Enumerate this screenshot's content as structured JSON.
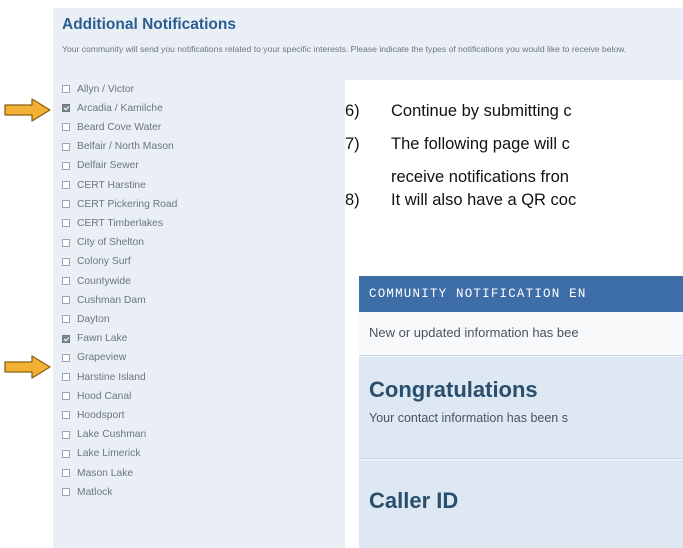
{
  "notifications": {
    "title": "Additional Notifications",
    "description": "Your community will send you notifications related to your specific interests. Please indicate the types of notifications you would like to receive below.",
    "options": [
      {
        "label": "Allyn / Victor",
        "checked": false
      },
      {
        "label": "Arcadia / Kamilche",
        "checked": true
      },
      {
        "label": "Beard Cove Water",
        "checked": false
      },
      {
        "label": "Belfair / North Mason",
        "checked": false
      },
      {
        "label": "Delfair Sewer",
        "checked": false
      },
      {
        "label": "CERT Harstine",
        "checked": false
      },
      {
        "label": "CERT Pickering Road",
        "checked": false
      },
      {
        "label": "CERT Timberlakes",
        "checked": false
      },
      {
        "label": "City of Shelton",
        "checked": false
      },
      {
        "label": "Colony Surf",
        "checked": false
      },
      {
        "label": "Countywide",
        "checked": false
      },
      {
        "label": "Cushman Dam",
        "checked": false
      },
      {
        "label": "Dayton",
        "checked": false
      },
      {
        "label": "Fawn Lake",
        "checked": true
      },
      {
        "label": "Grapeview",
        "checked": false
      },
      {
        "label": "Harstine Island",
        "checked": false
      },
      {
        "label": "Hood Canal",
        "checked": false
      },
      {
        "label": "Hoodsport",
        "checked": false
      },
      {
        "label": "Lake Cushman",
        "checked": false
      },
      {
        "label": "Lake Limerick",
        "checked": false
      },
      {
        "label": "Mason Lake",
        "checked": false
      },
      {
        "label": "Matlock",
        "checked": false
      }
    ]
  },
  "instructions": {
    "steps": [
      {
        "num": "6)",
        "text": "Continue by submitting c"
      },
      {
        "num": "7)",
        "text": "The following page will c"
      },
      {
        "num": "",
        "text": "receive notifications fron"
      },
      {
        "num": "8)",
        "text": "It will also have a QR coc"
      }
    ]
  },
  "confirmation": {
    "banner": "COMMUNITY NOTIFICATION EN",
    "message": "New or updated information has bee",
    "congrats_title": "Congratulations",
    "congrats_text": "Your contact information has been s",
    "caller_title": "Caller ID"
  },
  "colors": {
    "arrow_fill": "#f2b134",
    "arrow_stroke": "#8a6010",
    "banner": "#3d6ea8",
    "heading": "#2b5d91"
  }
}
